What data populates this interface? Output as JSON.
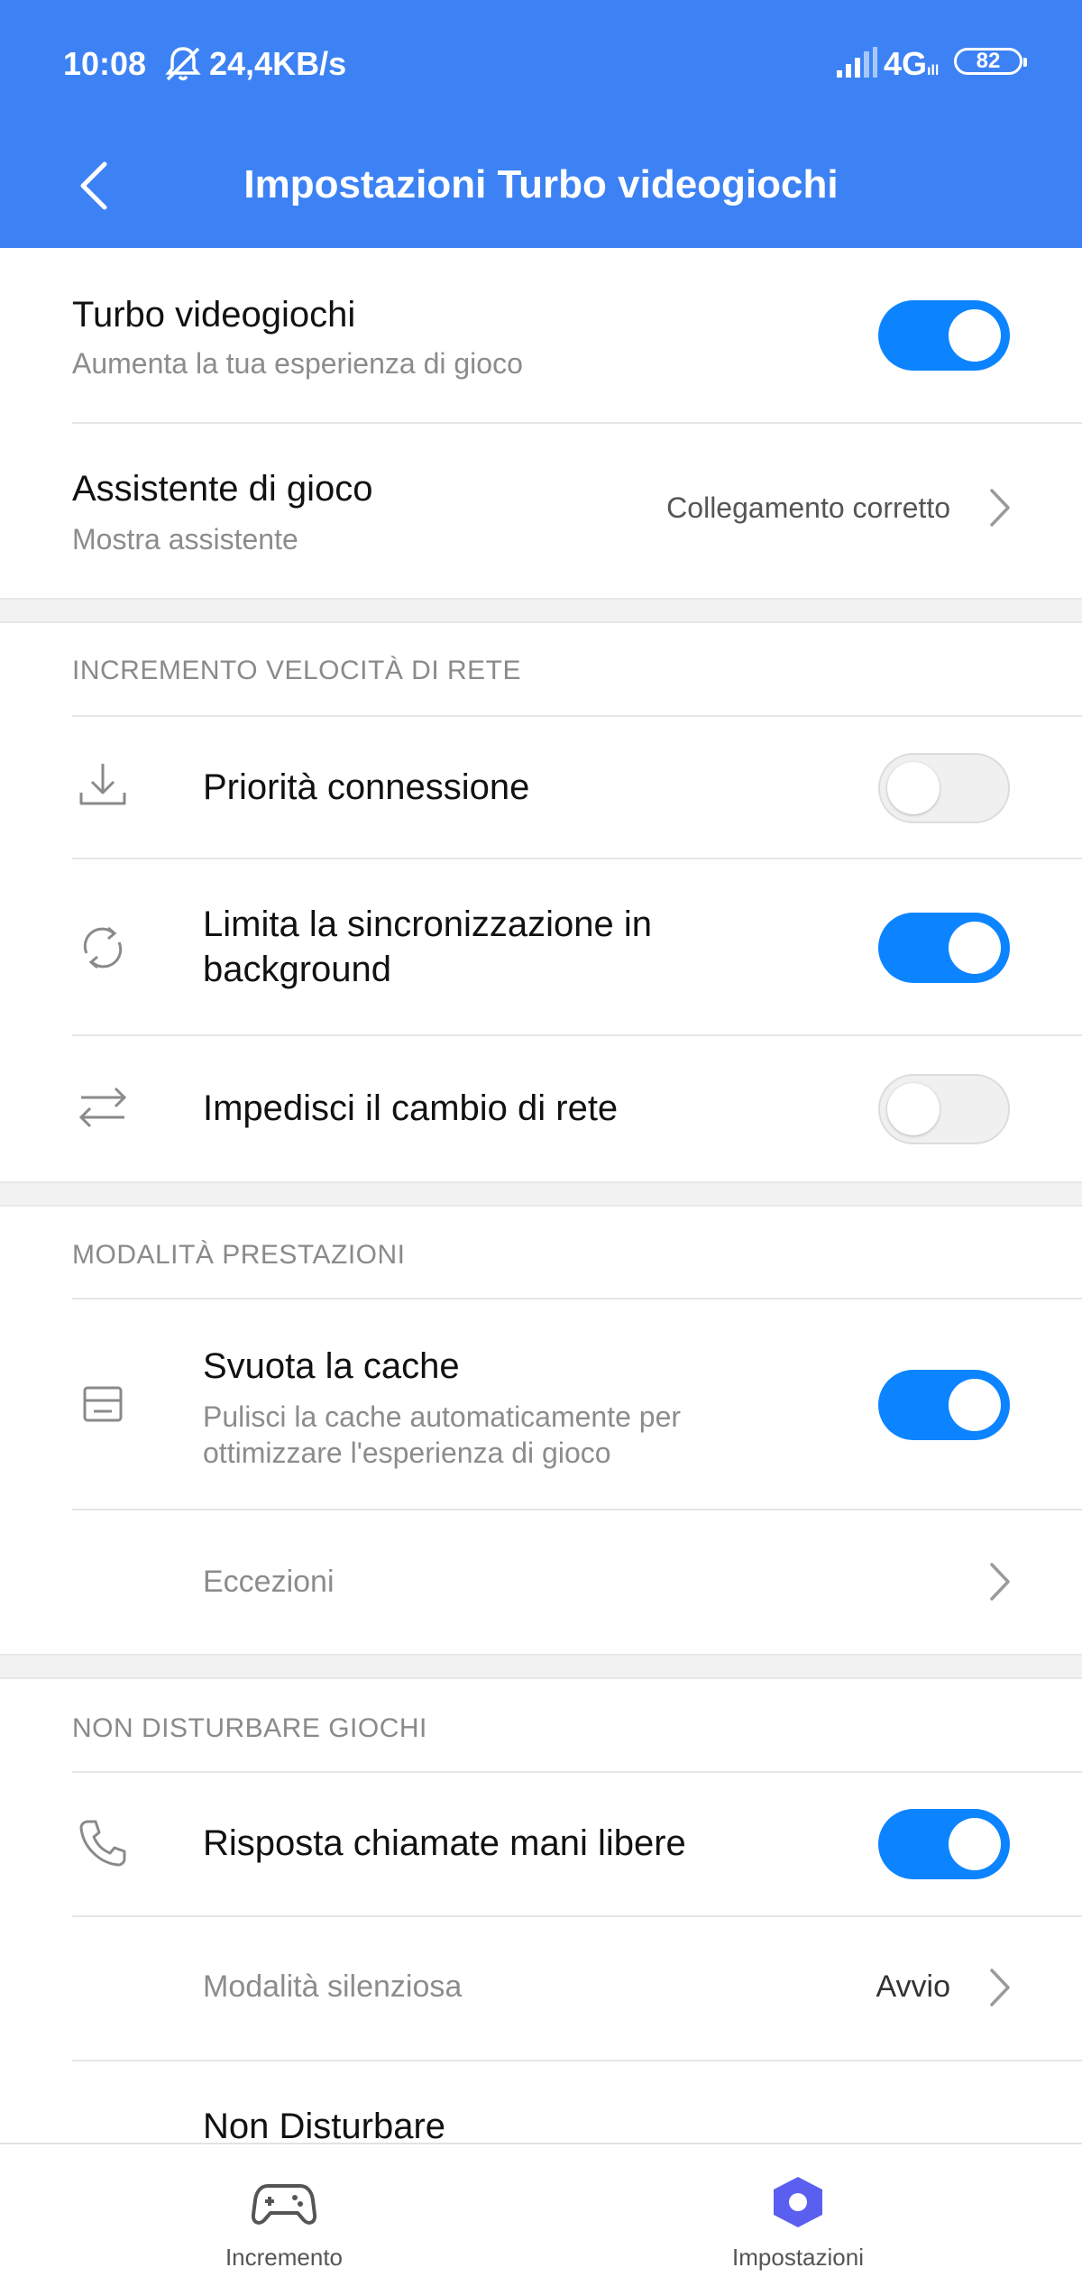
{
  "status_bar": {
    "time": "10:08",
    "speed": "24,4KB/s",
    "network": "4G",
    "network_sub": "ıll",
    "battery": "82"
  },
  "header": {
    "title": "Impostazioni Turbo videogiochi"
  },
  "colors": {
    "accent": "#3d82f4",
    "toggle_on": "#0d84ff",
    "nav_active": "#5b5ff0"
  },
  "general": {
    "turbo": {
      "title": "Turbo videogiochi",
      "subtitle": "Aumenta la tua esperienza di gioco",
      "enabled": true
    },
    "assistant": {
      "title": "Assistente di gioco",
      "subtitle": "Mostra assistente",
      "value": "Collegamento corretto"
    }
  },
  "network_section": {
    "header": "INCREMENTO VELOCITÀ DI RETE",
    "items": [
      {
        "icon": "download-icon",
        "title": "Priorità connessione",
        "enabled": false
      },
      {
        "icon": "sync-icon",
        "title_line1": "Limita la sincronizzazione in",
        "title_line2": "background",
        "enabled": true
      },
      {
        "icon": "swap-arrows-icon",
        "title": "Impedisci il cambio di rete",
        "enabled": false
      }
    ]
  },
  "performance_section": {
    "header": "MODALITÀ PRESTAZIONI",
    "cache": {
      "icon": "storage-icon",
      "title": "Svuota la cache",
      "subtitle_line1": "Pulisci la cache automaticamente per",
      "subtitle_line2": "ottimizzare l'esperienza di gioco",
      "enabled": true
    },
    "exceptions": {
      "title": "Eccezioni"
    }
  },
  "dnd_section": {
    "header": "NON DISTURBARE GIOCHI",
    "handsfree": {
      "icon": "phone-icon",
      "title": "Risposta chiamate mani libere",
      "enabled": true
    },
    "silent": {
      "title": "Modalità silenziosa",
      "value": "Avvio"
    },
    "dnd": {
      "title": "Non Disturbare"
    }
  },
  "bottom_nav": {
    "items": [
      {
        "label": "Incremento",
        "icon": "gamepad-icon",
        "active": false
      },
      {
        "label": "Impostazioni",
        "icon": "settings-gear-icon",
        "active": true
      }
    ]
  }
}
